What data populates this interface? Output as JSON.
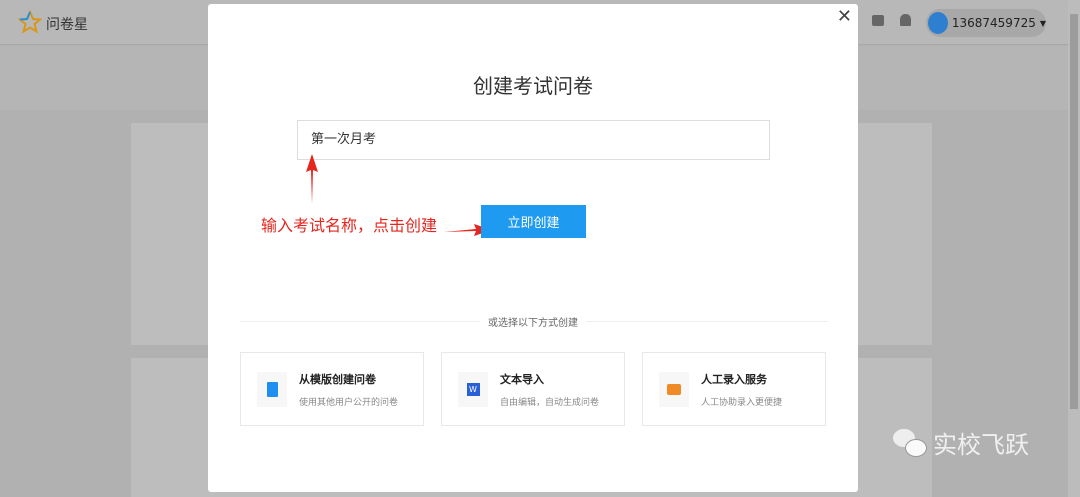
{
  "header": {
    "app_name": "问卷星",
    "username": "13687459725"
  },
  "modal": {
    "title": "创建考试问卷",
    "name_value": "第一次月考",
    "create_button": "立即创建",
    "annotation": "输入考试名称，点击创建",
    "divider_text": "或选择以下方式创建",
    "options": [
      {
        "title": "从模版创建问卷",
        "desc": "使用其他用户公开的问卷",
        "color": "#1e8ff0"
      },
      {
        "title": "文本导入",
        "desc": "自由编辑，自动生成问卷",
        "color": "#2b5fd6"
      },
      {
        "title": "人工录入服务",
        "desc": "人工协助录入更便捷",
        "color": "#f08a24"
      }
    ]
  },
  "watermark": "实校飞跃"
}
